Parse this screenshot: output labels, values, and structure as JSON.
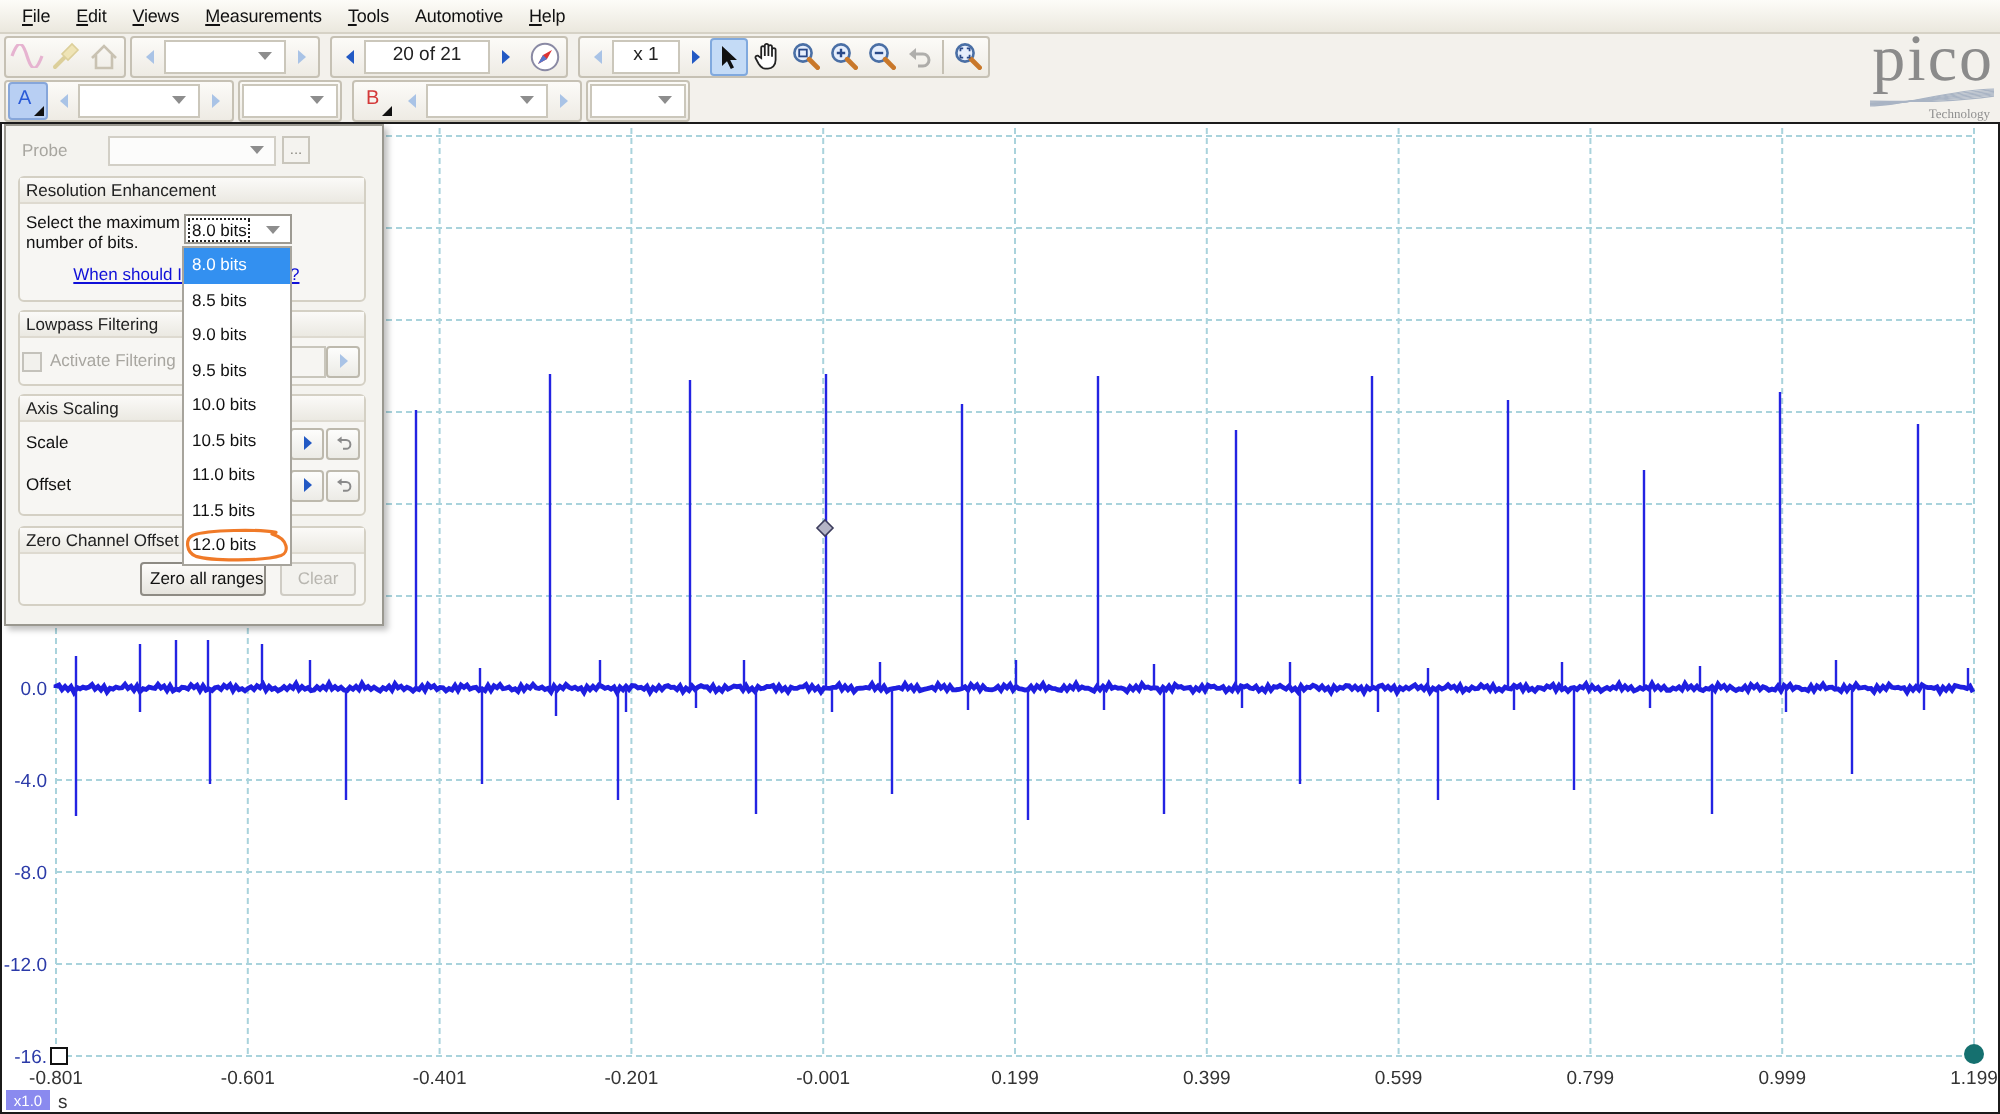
{
  "menu": [
    {
      "label": "File",
      "access_key_shown": true
    },
    {
      "label": "Edit",
      "access_key_shown": true
    },
    {
      "label": "Views",
      "access_key_shown": true
    },
    {
      "label": "Measurements",
      "access_key_shown": true
    },
    {
      "label": "Tools",
      "access_key_shown": true
    },
    {
      "label": "Automotive",
      "access_key_shown": false
    },
    {
      "label": "Help",
      "access_key_shown": true
    }
  ],
  "toolbar": {
    "buttons": [
      {
        "disabled": true
      },
      {
        "disabled": true
      },
      {
        "disabled": true
      }
    ],
    "capture_stepper": {
      "kind": "dropdown",
      "prev_disabled": true,
      "next_disabled": true
    },
    "buffer_stepper": {
      "kind": "field",
      "value": "20 of 21",
      "prev_disabled": false,
      "next_disabled": false
    },
    "zoom_stepper": {
      "kind": "field",
      "value": "x 1",
      "prev_disabled": true,
      "next_disabled": false
    },
    "tools": [
      {
        "selected": true,
        "disabled": false
      },
      {
        "selected": false,
        "disabled": false
      },
      {
        "selected": false,
        "disabled": false
      },
      {
        "selected": false,
        "disabled": false
      },
      {
        "selected": false,
        "disabled": false
      },
      {
        "selected": false,
        "disabled": true
      },
      {
        "selected": false,
        "disabled": false
      }
    ]
  },
  "channel_bar": {
    "channels": [
      {
        "label": "A",
        "color": "#2b5bd8",
        "selected": true,
        "prev_disabled": true,
        "next_disabled": true
      },
      {
        "label": "B",
        "color": "#d43a3a",
        "selected": false,
        "prev_disabled": true,
        "next_disabled": true
      }
    ]
  },
  "logo": {
    "wordmark": "pico",
    "tagline": "Technology"
  },
  "channel_panel": {
    "probe": {
      "label": "Probe",
      "more_button": "...",
      "disabled": true
    },
    "resolution": {
      "title": "Resolution Enhancement",
      "prompt": "Select the maximum number of bits.",
      "value": "8.0 bits",
      "help_link_start": "When should I",
      "help_link_end": "?",
      "options": [
        {
          "label": "8.0 bits",
          "selected": true,
          "circled": false
        },
        {
          "label": "8.5 bits",
          "selected": false,
          "circled": false
        },
        {
          "label": "9.0 bits",
          "selected": false,
          "circled": false
        },
        {
          "label": "9.5 bits",
          "selected": false,
          "circled": false
        },
        {
          "label": "10.0 bits",
          "selected": false,
          "circled": false
        },
        {
          "label": "10.5 bits",
          "selected": false,
          "circled": false
        },
        {
          "label": "11.0 bits",
          "selected": false,
          "circled": false
        },
        {
          "label": "11.5 bits",
          "selected": false,
          "circled": false
        },
        {
          "label": "12.0 bits",
          "selected": false,
          "circled": true
        }
      ]
    },
    "lowpass": {
      "title": "Lowpass Filtering",
      "filter": {
        "label": "Activate Filtering",
        "checked": false,
        "disabled": true
      }
    },
    "axis_scaling": {
      "title": "Axis Scaling",
      "rows": [
        {
          "label": "Scale"
        },
        {
          "label": "Offset"
        }
      ]
    },
    "zero_offsets": {
      "title": "Zero Channel Offset",
      "buttons": [
        {
          "label": "Zero all ranges",
          "disabled": false
        },
        {
          "label": "Clear",
          "disabled": true
        }
      ]
    }
  },
  "plot": {
    "y_labels": [
      "0.0",
      "-4.0",
      "-8.0",
      "-12.0",
      "-16."
    ],
    "x_labels": [
      "-0.801",
      "-0.601",
      "-0.401",
      "-0.201",
      "-0.001",
      "0.199",
      "0.399",
      "0.599",
      "0.799",
      "0.999",
      "1.199"
    ],
    "x_unit": "s",
    "zoom_badge": "x1.0"
  }
}
